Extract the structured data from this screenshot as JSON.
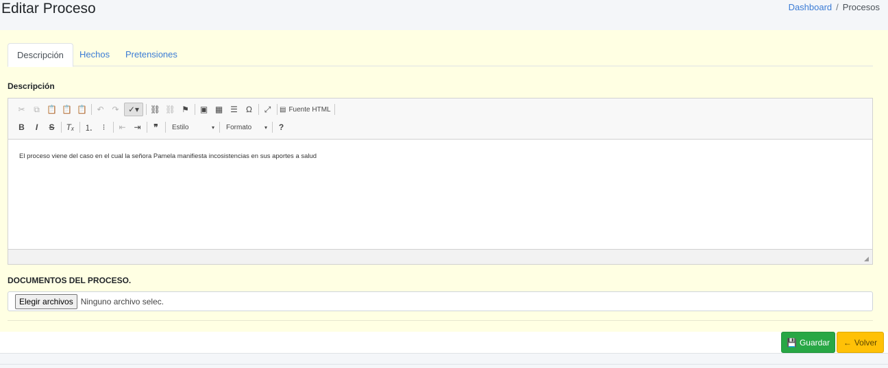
{
  "header": {
    "title": "Editar Proceso",
    "breadcrumb": {
      "home": "Dashboard",
      "separator": "/",
      "current": "Procesos"
    }
  },
  "tabs": [
    {
      "label": "Descripción",
      "active": true
    },
    {
      "label": "Hechos",
      "active": false
    },
    {
      "label": "Pretensiones",
      "active": false
    }
  ],
  "form": {
    "description_label": "Descripción",
    "editor": {
      "toolbar": {
        "source_label": "Fuente HTML",
        "style_label": "Estilo",
        "format_label": "Formato",
        "bold": "B",
        "italic": "I",
        "strike": "S",
        "help": "?",
        "omega": "Ω"
      },
      "content": "El proceso viene del caso en el cual la señora Pamela manifiesta incosistencias en sus aportes a salud"
    },
    "documents_label": "DOCUMENTOS DEL PROCESO.",
    "file_input": {
      "button_label": "Elegir archivos",
      "status": "Ninguno archivo selec."
    }
  },
  "actions": {
    "save_label": "Guardar",
    "back_label": "Volver"
  },
  "colors": {
    "card_bg": "#ffffe3",
    "link": "#3a7bd5",
    "save": "#28a745",
    "back": "#ffc107"
  }
}
